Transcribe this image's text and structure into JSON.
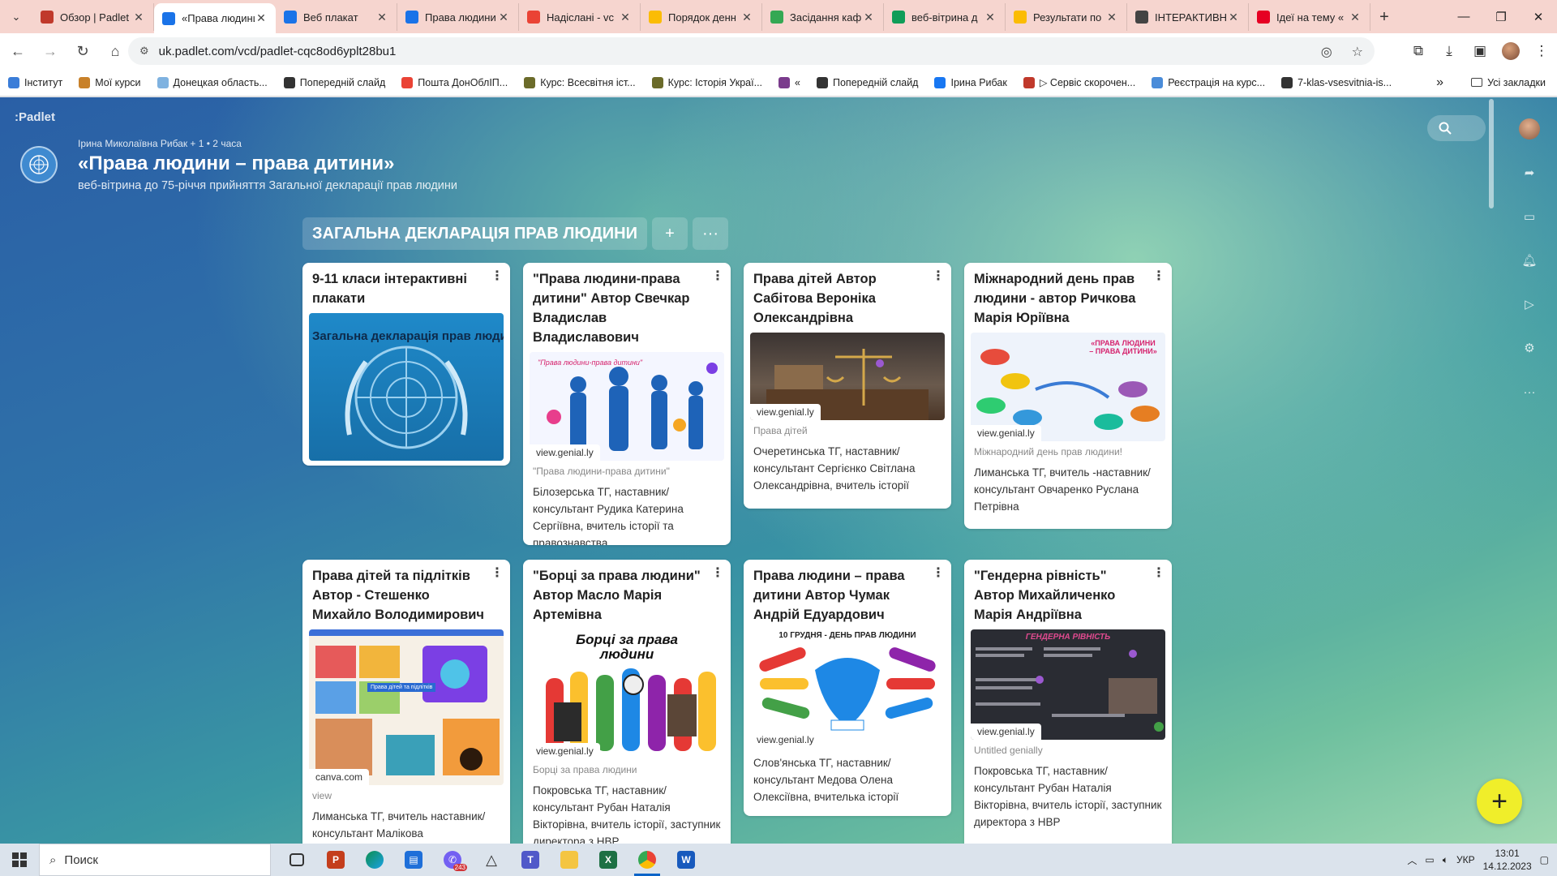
{
  "browser": {
    "tabs": [
      {
        "title": "Обзор | Padlet",
        "color": "#c0392b",
        "active": false
      },
      {
        "title": "«Права людини",
        "color": "#1a73e8",
        "active": true
      },
      {
        "title": "Веб плакат",
        "color": "#1a73e8",
        "active": false
      },
      {
        "title": "Права людини",
        "color": "#1a73e8",
        "active": false
      },
      {
        "title": "Надіслані - vc",
        "color": "#ea4335",
        "active": false
      },
      {
        "title": "Порядок денн",
        "color": "#fbbc04",
        "active": false
      },
      {
        "title": "Засідання каф",
        "color": "#34a853",
        "active": false
      },
      {
        "title": "веб-вітрина д",
        "color": "#0f9d58",
        "active": false
      },
      {
        "title": "Результати по",
        "color": "#fbbc04",
        "active": false
      },
      {
        "title": "ІНТЕРАКТИВН",
        "color": "#444444",
        "active": false
      },
      {
        "title": "Ідеї на тему «",
        "color": "#e60023",
        "active": false
      }
    ],
    "url": "uk.padlet.com/vcd/padlet-cqc8od6yplt28bu1",
    "bookmarks": [
      {
        "label": "Інститут",
        "color": "#3b7dd8"
      },
      {
        "label": "Мої курси",
        "color": "#c8812a"
      },
      {
        "label": "Донецкая область...",
        "color": "#7fb2e0"
      },
      {
        "label": "Попередній слайд",
        "color": "#333333"
      },
      {
        "label": "Пошта ДонОблІП...",
        "color": "#ea4335"
      },
      {
        "label": "Курс: Всесвітня іст...",
        "color": "#6b6b2a"
      },
      {
        "label": "Курс: Історія Украї...",
        "color": "#6b6b2a"
      },
      {
        "label": "«",
        "color": "#7a3b8c"
      },
      {
        "label": "Попередній слайд",
        "color": "#333333"
      },
      {
        "label": "Ірина Рибак",
        "color": "#1877f2"
      },
      {
        "label": "▷ Сервіс скорочен...",
        "color": "#c0392b"
      },
      {
        "label": "Реєстрація на курс...",
        "color": "#4a8cd9"
      },
      {
        "label": "7-klas-vsesvitnia-is...",
        "color": "#333333"
      }
    ],
    "all_bookmarks": "Усі закладки"
  },
  "padlet": {
    "logo": ":Padlet",
    "meta": "Ірина Миколаївна Рибак + 1 •  2 часа",
    "title": "«Права людини – права дитини»",
    "subtitle": "веб-вітрина до 75-річчя прийняття Загальної декларації прав людини",
    "section": {
      "title": "ЗАГАЛЬНА ДЕКЛАРАЦІЯ ПРАВ ЛЮДИНИ",
      "add": "+",
      "more": "···"
    },
    "fab": "+",
    "cards": [
      {
        "title": "9-11 класи інтерактивні плакати",
        "thumb_text": "Загальна декларація прав людини",
        "tag": "",
        "caption": "",
        "body": ""
      },
      {
        "title": "\"Права людини-права дитини\"     Автор Свечкар Владислав Владиславович",
        "thumb_text": "\"Права людини-права дитини\"",
        "tag": "view.genial.ly",
        "caption": "\"Права людини-права дитини\"",
        "body": "Білозерська ТГ, наставник/консультант Рудика Катерина Сергіївна, вчитель історії та правознавства"
      },
      {
        "title": "Права дітей      Автор Сабітова Вероніка Олександрівна",
        "thumb_text": "",
        "tag": "view.genial.ly",
        "caption": "Права дітей",
        "body": "Очеретинська ТГ, наставник/консультант Сергієнко Світлана Олександрівна, вчитель історії"
      },
      {
        "title": "Міжнародний день прав людини - автор Ричкова Марія Юріївна",
        "thumb_text": "«ПРАВА ЛЮДИНИ – ПРАВА ДИТИНИ»",
        "tag": "view.genial.ly",
        "caption": "Міжнародний день прав людини!",
        "body": "Лиманська ТГ, вчитель -наставник/консультант Овчаренко Руслана Петрівна"
      },
      {
        "title": "Права дітей та підлітків Автор - Стешенко Михайло Володимирович",
        "thumb_text": "Права дітей та підлітків",
        "tag": "canva.com",
        "caption": "view",
        "body": "Лиманська ТГ, вчитель наставник/консультант Малікова"
      },
      {
        "title": "\"Борці за права людини\"     Автор Масло Марія Артемівна",
        "thumb_text": "Борці за права людини",
        "tag": "view.genial.ly",
        "caption": "Борці за права людини",
        "body": "Покровська ТГ, наставник/консультант Рубан Наталія Вікторівна, вчитель історії, заступник директора з НВР"
      },
      {
        "title": "Права людини – права дитини  Автор Чумак Андрій Едуардович",
        "thumb_text": "10 ГРУДНЯ - ДЕНЬ ПРАВ ЛЮДИНИ",
        "tag": "view.genial.ly",
        "caption": "",
        "body": "Слов'янська ТГ, наставник/консультант Медова Олена Олексіївна, вчителька історії"
      },
      {
        "title": "\"Гендерна рівність\"     Автор  Михайличенко Марія Андріївна",
        "thumb_text": "ГЕНДЕРНА РІВНІСТЬ",
        "tag": "view.genial.ly",
        "caption": "Untitled genially",
        "body": "Покровська ТГ, наставник/консультант Рубан Наталія Вікторівна, вчитель історії, заступник директора з НВР"
      }
    ]
  },
  "taskbar": {
    "search": "Поиск",
    "lang": "УКР",
    "time": "13:01",
    "date": "14.12.2023",
    "badge": "243"
  }
}
